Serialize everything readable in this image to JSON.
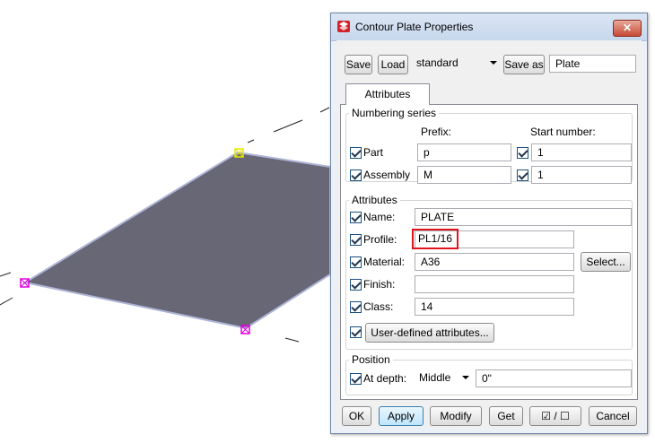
{
  "dialog": {
    "title": "Contour Plate Properties",
    "close": "✕"
  },
  "toolbar": {
    "save": "Save",
    "load": "Load",
    "preset": "standard",
    "save_as": "Save as",
    "save_as_name": "Plate"
  },
  "tabs": {
    "attributes": "Attributes"
  },
  "numbering": {
    "title": "Numbering series",
    "prefix_header": "Prefix:",
    "start_header": "Start number:",
    "part_label": "Part",
    "part_prefix": "p",
    "part_start": "1",
    "assembly_label": "Assembly",
    "assembly_prefix": "M",
    "assembly_start": "1"
  },
  "attributes": {
    "title": "Attributes",
    "name_label": "Name:",
    "name_value": "PLATE",
    "profile_label": "Profile:",
    "profile_value": "PL1/16",
    "material_label": "Material:",
    "material_value": "A36",
    "select": "Select...",
    "finish_label": "Finish:",
    "finish_value": "",
    "class_label": "Class:",
    "class_value": "14",
    "user_defined": "User-defined attributes..."
  },
  "position": {
    "title": "Position",
    "depth_label": "At depth:",
    "depth_option": "Middle",
    "depth_offset": "0\""
  },
  "footer": {
    "ok": "OK",
    "apply": "Apply",
    "modify": "Modify",
    "get": "Get",
    "toggle": "☑ / ☐",
    "cancel": "Cancel"
  },
  "colors": {
    "plate": "#676775",
    "plate_edge": "#aeb4d6",
    "highlight": "#e0151c",
    "handle_yellow": "#e8e800",
    "handle_magenta": "#e000e0"
  }
}
